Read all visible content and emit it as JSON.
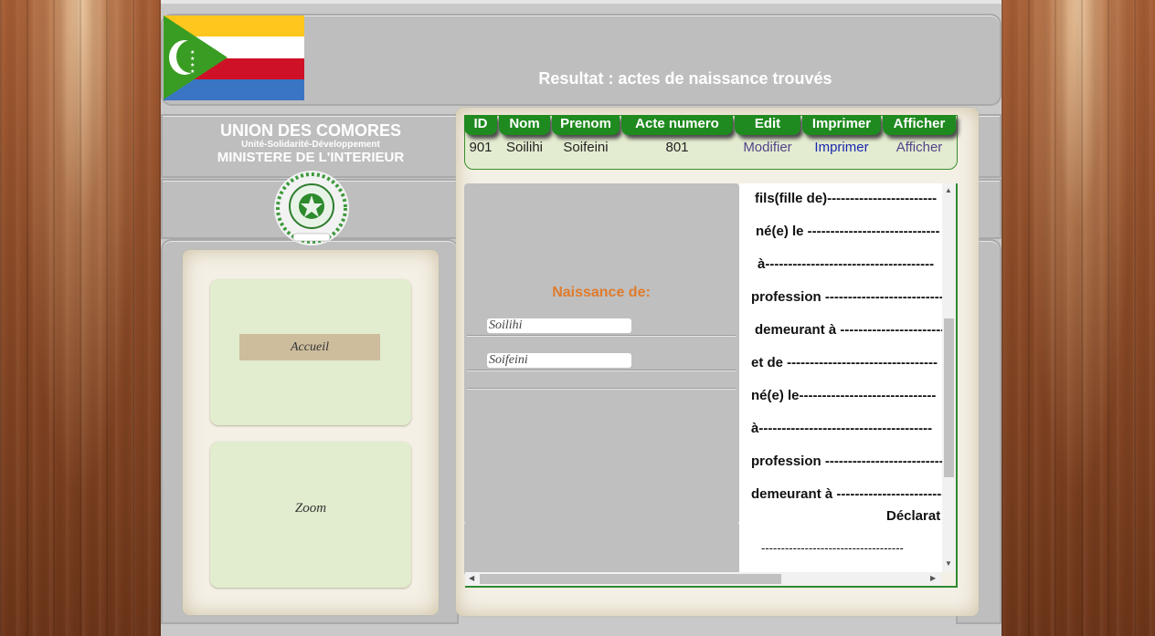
{
  "header": {
    "result_title": "Resultat : actes de naissance trouvés"
  },
  "brand": {
    "line1": "UNION DES COMORES",
    "line2": "Unité-Solidarité-Développement",
    "line3": "MINISTERE DE L'INTERIEUR"
  },
  "nav": {
    "accueil": "Accueil",
    "zoom": "Zoom"
  },
  "table": {
    "headers": [
      "ID",
      "Nom",
      "Prenom",
      "Acte numero",
      "Edit",
      "Imprimer",
      "Afficher"
    ],
    "row": {
      "id": "901",
      "nom": "Soilihi",
      "prenom": "Soifeini",
      "acte": "801",
      "edit": "Modifier",
      "imprimer": "Imprimer",
      "afficher": "Afficher"
    }
  },
  "form": {
    "title": "Naissance de:",
    "nom": "Soilihi",
    "prenom": "Soifeini"
  },
  "document": {
    "lines": [
      "fils(fille de)------------------------",
      "né(e) le -----------------------------",
      "à-------------------------------------",
      "profession ---------------------------",
      "demeurant à -------------------------",
      "et de ---------------------------------",
      "né(e) le------------------------------",
      "à--------------------------------------",
      "profession ---------------------------",
      "demeurant à -------------------------",
      "Déclarat",
      "------------------------------------"
    ]
  },
  "colors": {
    "table_header": "#1f8a20",
    "accent_orange": "#e07b2c",
    "link_blue": "#1a27b0"
  }
}
